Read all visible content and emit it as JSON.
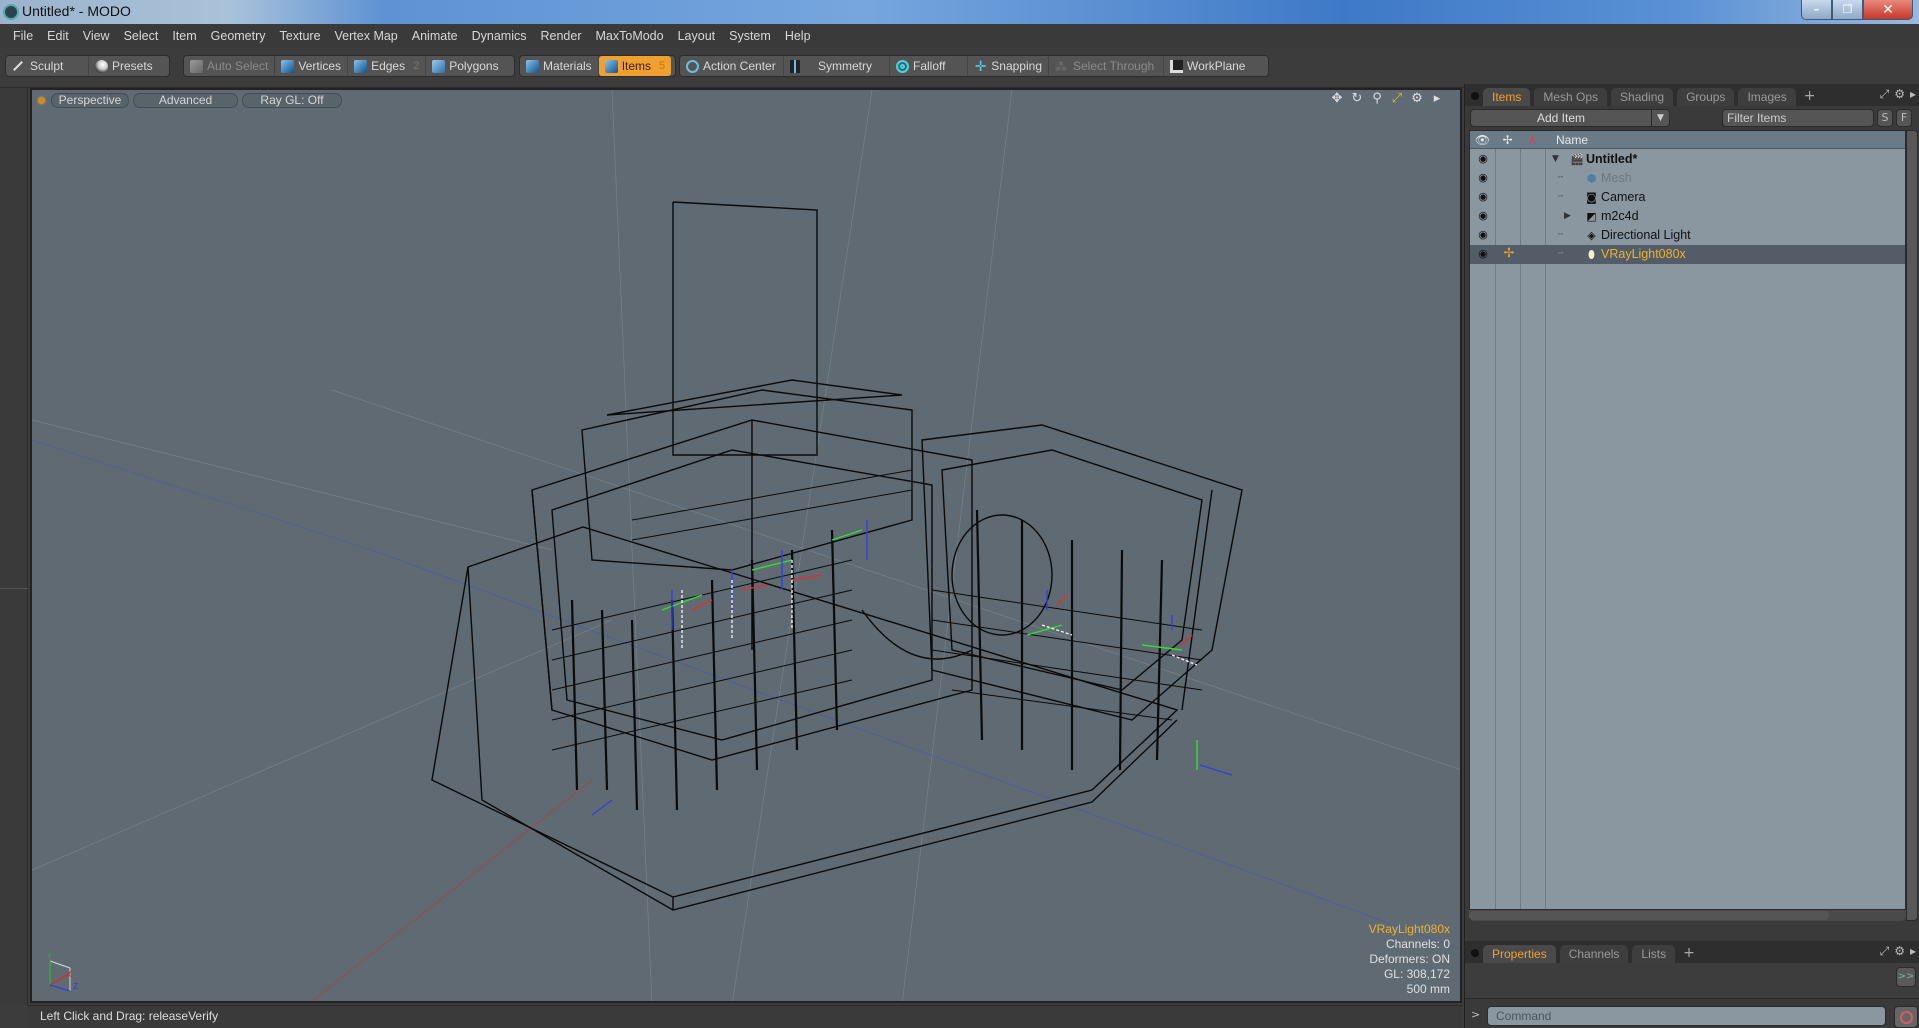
{
  "window": {
    "title": "Untitled* - MODO",
    "controls": {
      "minimize": "–",
      "restore": "❐",
      "close": "✕"
    }
  },
  "menu": [
    "File",
    "Edit",
    "View",
    "Select",
    "Item",
    "Geometry",
    "Texture",
    "Vertex Map",
    "Animate",
    "Dynamics",
    "Render",
    "MaxToModo",
    "Layout",
    "System",
    "Help"
  ],
  "toolbar": {
    "left_group": [
      {
        "label": "Sculpt",
        "icon": "brush-icon"
      },
      {
        "label": "Presets",
        "icon": "preset-ball-icon"
      }
    ],
    "selection_modes": [
      {
        "label": "Auto Select",
        "icon": "cube-icon",
        "state": "disabled"
      },
      {
        "label": "Vertices",
        "icon": "cube-icon"
      },
      {
        "label": "Edges",
        "icon": "cube-icon",
        "badge": "2"
      },
      {
        "label": "Polygons",
        "icon": "cube-icon"
      }
    ],
    "item_modes": [
      {
        "label": "Materials",
        "icon": "cube-icon"
      },
      {
        "label": "Items",
        "icon": "cube-icon",
        "badge": "5",
        "state": "active"
      }
    ],
    "tools": [
      {
        "label": "Action Center",
        "icon": "crosshair-icon"
      },
      {
        "label": "Symmetry",
        "icon": "symmetry-icon"
      },
      {
        "label": "Falloff",
        "icon": "falloff-icon"
      },
      {
        "label": "Snapping",
        "icon": "snap-icon"
      },
      {
        "label": "Select Through",
        "icon": "select-through-icon",
        "state": "disabled"
      },
      {
        "label": "WorkPlane",
        "icon": "workplane-icon"
      }
    ]
  },
  "viewport": {
    "view_mode": "Perspective",
    "shading": "Advanced",
    "raygl": "Ray GL: Off",
    "tools": [
      "move-view-icon",
      "rotate-view-icon",
      "zoom-view-icon",
      "fit-view-icon",
      "settings-icon",
      "more-arrow-icon"
    ],
    "info": {
      "selected": "VRayLight080x",
      "channels": "Channels: 0",
      "deformers": "Deformers: ON",
      "gl": "GL: 308,172",
      "scale": "500 mm"
    },
    "axis_labels": {
      "x": "X",
      "y": "Y",
      "z": "Z"
    }
  },
  "statusbar": {
    "text": "Left Click and Drag:  releaseVerify"
  },
  "items_panel": {
    "tabs": [
      {
        "label": "Items",
        "active": true
      },
      {
        "label": "Mesh Ops"
      },
      {
        "label": "Shading"
      },
      {
        "label": "Groups"
      },
      {
        "label": "Images"
      }
    ],
    "add_tab": "+",
    "add_item_label": "Add Item",
    "filter_placeholder": "Filter Items",
    "s_button": "S",
    "f_button": "F",
    "columns": {
      "name": "Name"
    },
    "items": [
      {
        "label": "Untitled*",
        "icon": "scene-clapper-icon",
        "level": 0,
        "expander": "▼",
        "bold": true
      },
      {
        "label": "Mesh",
        "icon": "mesh-cube-icon",
        "level": 1,
        "dim": true
      },
      {
        "label": "Camera",
        "icon": "camera-icon",
        "level": 1
      },
      {
        "label": "m2c4d",
        "icon": "group-folder-icon",
        "level": 1,
        "expander": "▶"
      },
      {
        "label": "Directional Light",
        "icon": "directional-light-icon",
        "level": 1
      },
      {
        "label": "VRayLight080x",
        "icon": "vray-light-icon",
        "level": 1,
        "selected": true
      }
    ]
  },
  "properties_panel": {
    "tabs": [
      {
        "label": "Properties",
        "active": true
      },
      {
        "label": "Channels"
      },
      {
        "label": "Lists"
      }
    ],
    "add_tab": "+",
    "expand_button": ">>"
  },
  "command": {
    "prompt": ">",
    "placeholder": "Command"
  },
  "colors": {
    "accent": "#f0a030",
    "viewport_bg": "#5f6a72",
    "list_bg": "#8a96a0",
    "selected_row": "#525d68"
  }
}
